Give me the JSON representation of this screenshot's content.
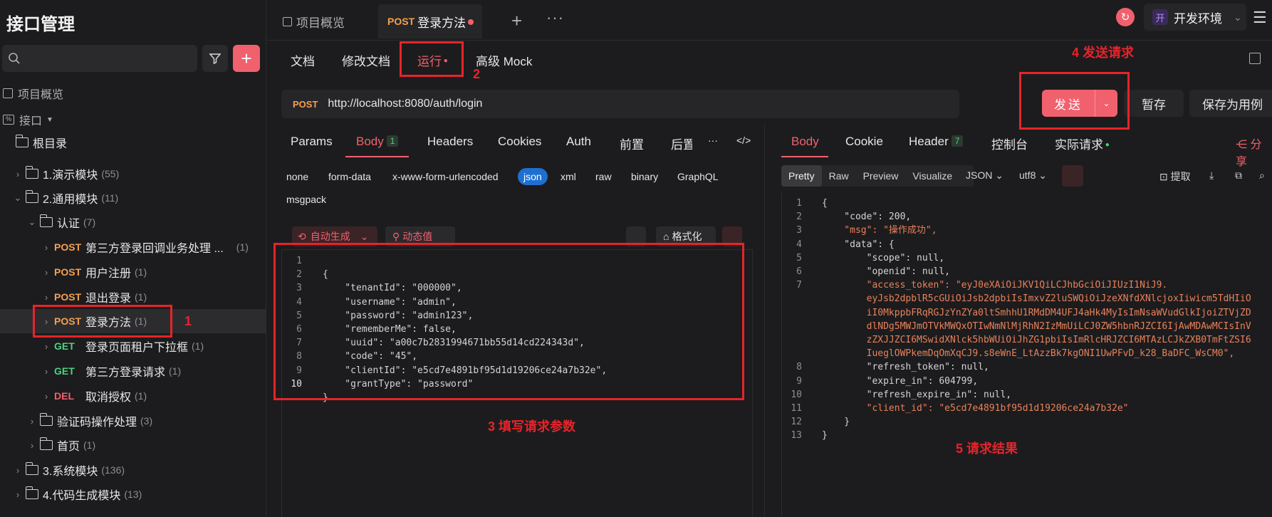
{
  "sidebar": {
    "title": "接口管理",
    "search_placeholder": "",
    "overview": "项目概览",
    "api_root": "接口",
    "root_dir": "根目录",
    "tree": [
      {
        "label": "1.演示模块",
        "count": "(55)"
      },
      {
        "label": "2.通用模块",
        "count": "(11)"
      },
      {
        "label": "认证",
        "count": "(7)"
      },
      {
        "method": "POST",
        "label": "第三方登录回调业务处理 ...",
        "count": "(1)"
      },
      {
        "method": "POST",
        "label": "用户注册",
        "count": "(1)"
      },
      {
        "method": "POST",
        "label": "退出登录",
        "count": "(1)"
      },
      {
        "method": "POST",
        "label": "登录方法",
        "count": "(1)"
      },
      {
        "method": "GET",
        "label": "登录页面租户下拉框",
        "count": "(1)"
      },
      {
        "method": "GET",
        "label": "第三方登录请求",
        "count": "(1)"
      },
      {
        "method": "DEL",
        "label": "取消授权",
        "count": "(1)"
      },
      {
        "label": "验证码操作处理",
        "count": "(3)"
      },
      {
        "label": "首页",
        "count": "(1)"
      },
      {
        "label": "3.系统模块",
        "count": "(136)"
      },
      {
        "label": "4.代码生成模块",
        "count": "(13)"
      }
    ]
  },
  "topbar": {
    "tab_overview": "项目概览",
    "tab_active_method": "POST",
    "tab_active": "登录方法",
    "env": "开发环境",
    "env_badge": "开"
  },
  "subtabs": [
    "文档",
    "修改文档",
    "运行",
    "高级 Mock"
  ],
  "request": {
    "method": "POST",
    "url": "http://localhost:8080/auth/login",
    "send": "发送",
    "save": "暂存",
    "save_as": "保存为用例"
  },
  "req_tabs": [
    "Params",
    "Body",
    "Headers",
    "Cookies",
    "Auth",
    "前置",
    "后置"
  ],
  "body_badge": "1",
  "body_types": [
    "none",
    "form-data",
    "x-www-form-urlencoded",
    "json",
    "xml",
    "raw",
    "binary",
    "GraphQL",
    "msgpack"
  ],
  "tools": {
    "auto": "自动生成",
    "dynamic": "动态值",
    "format": "格式化"
  },
  "request_body": [
    "{",
    "    \"tenantId\": \"000000\",",
    "    \"username\": \"admin\",",
    "    \"password\": \"admin123\",",
    "    \"rememberMe\": false,",
    "    \"uuid\": \"a00c7b2831994671bb55d14cd224343d\",",
    "    \"code\": \"45\",",
    "    \"clientId\": \"e5cd7e4891bf95d1d19206ce24a7b32e\",",
    "    \"grantType\": \"password\"",
    "}"
  ],
  "resp_tabs": [
    "Body",
    "Cookie",
    "Header",
    "控制台",
    "实际请求"
  ],
  "header_badge": "7",
  "share": "分享",
  "resp_views": [
    "Pretty",
    "Raw",
    "Preview",
    "Visualize"
  ],
  "resp_format": "JSON",
  "resp_encoding": "utf8",
  "extract": "提取",
  "response_body": [
    {
      "n": "1",
      "t": "{"
    },
    {
      "n": "2",
      "t": "    \"code\": 200,"
    },
    {
      "n": "3",
      "t": "    \"msg\": \"操作成功\","
    },
    {
      "n": "4",
      "t": "    \"data\": {"
    },
    {
      "n": "5",
      "t": "        \"scope\": null,"
    },
    {
      "n": "6",
      "t": "        \"openid\": null,"
    },
    {
      "n": "7",
      "t": "        \"access_token\": \"eyJ0eXAiOiJKV1QiLCJhbGciOiJIUzI1NiJ9."
    },
    {
      "n": "",
      "t": "        eyJsb2dpblR5cGUiOiJsb2dpbiIsImxvZ2luSWQiOiJzeXNfdXNlcjoxIiwicm5TdHIiO"
    },
    {
      "n": "",
      "t": "        iI0MkppbFRqRGJzYnZYa0ltSmhhU1RMdDM4UFJ4aHk4MyIsImNsaWVudGlkIjoiZTVjZD"
    },
    {
      "n": "",
      "t": "        dlNDg5MWJmOTVkMWQxOTIwNmNlMjRhN2IzMmUiLCJ0ZW5hbnRJZCI6IjAwMDAwMCIsInV"
    },
    {
      "n": "",
      "t": "        zZXJJZCI6MSwidXNlck5hbWUiOiJhZG1pbiIsImRlcHRJZCI6MTAzLCJkZXB0TmFtZSI6"
    },
    {
      "n": "",
      "t": "        IueglOWPkemDqOmXqCJ9.s8eWnE_LtAzzBk7kgONI1UwPFvD_k28_BaDFC_WsCM0\","
    },
    {
      "n": "8",
      "t": "        \"refresh_token\": null,"
    },
    {
      "n": "9",
      "t": "        \"expire_in\": 604799,"
    },
    {
      "n": "10",
      "t": "        \"refresh_expire_in\": null,"
    },
    {
      "n": "11",
      "t": "        \"client_id\": \"e5cd7e4891bf95d1d19206ce24a7b32e\""
    },
    {
      "n": "12",
      "t": "    }"
    },
    {
      "n": "13",
      "t": "}"
    }
  ],
  "annotations": {
    "a1": "1",
    "a2": "2",
    "a3": "3 填写请求参数",
    "a4": "4 发送请求",
    "a5": "5 请求结果"
  }
}
